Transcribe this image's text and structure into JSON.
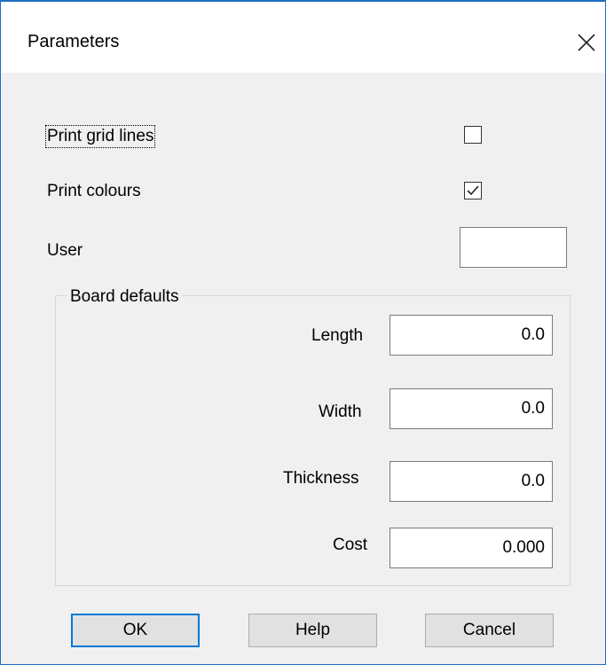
{
  "dialog": {
    "title": "Parameters"
  },
  "options": {
    "print_grid_lines": {
      "label": "Print grid lines",
      "checked": false
    },
    "print_colours": {
      "label": "Print colours",
      "checked": true
    },
    "user": {
      "label": "User",
      "value": ""
    }
  },
  "board_defaults": {
    "group_label": "Board defaults",
    "length": {
      "label": "Length",
      "value": "0.0"
    },
    "width": {
      "label": "Width",
      "value": "0.0"
    },
    "thickness": {
      "label": "Thickness",
      "value": "0.0"
    },
    "cost": {
      "label": "Cost",
      "value": "0.000"
    }
  },
  "buttons": {
    "ok": "OK",
    "help": "Help",
    "cancel": "Cancel"
  },
  "colors": {
    "accent": "#0078d7",
    "window_border": "#1e6fc4",
    "background": "#f0f0f0"
  },
  "icons": {
    "close": "close-icon",
    "check": "checkmark-icon"
  }
}
